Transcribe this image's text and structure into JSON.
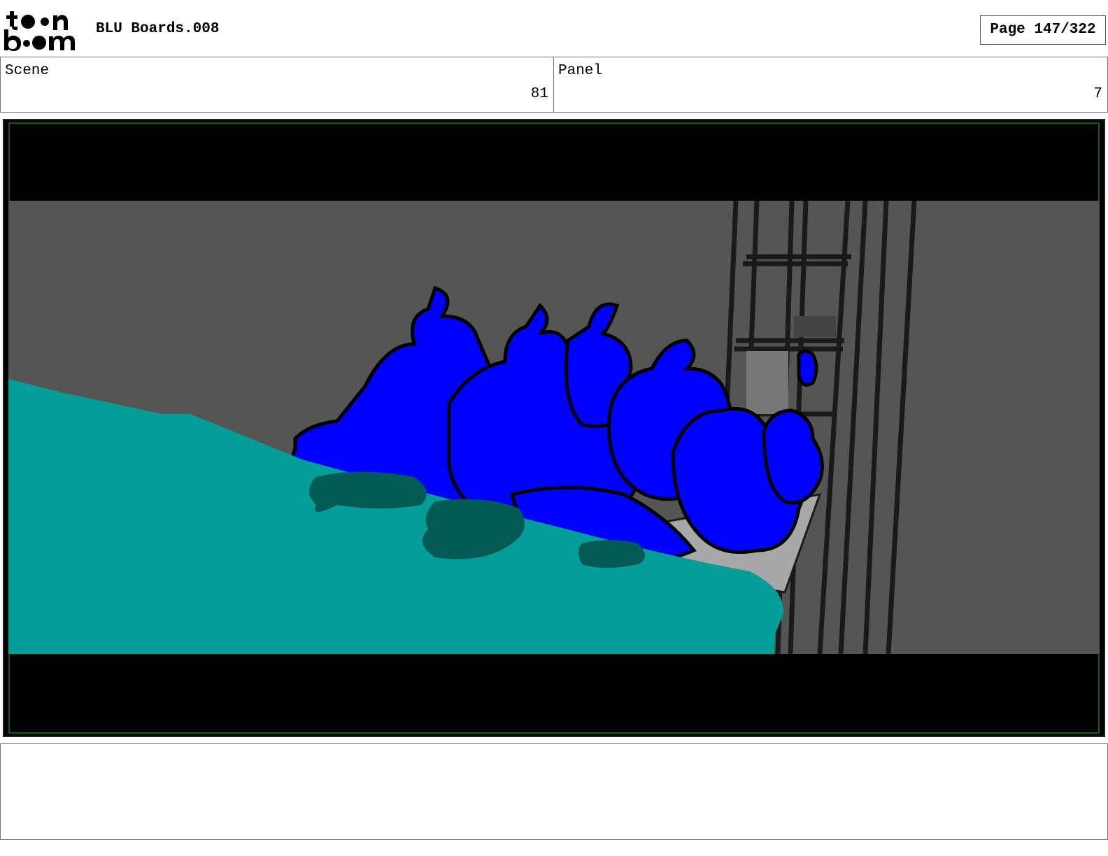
{
  "header": {
    "title": "BLU Boards.008",
    "page": "Page 147/322",
    "logo_text": "toonboom"
  },
  "scene": {
    "label": "Scene",
    "value": "81"
  },
  "panel": {
    "label": "Panel",
    "value": "7"
  },
  "notes": {
    "text": ""
  },
  "colors": {
    "frame": "#000000",
    "frame_border": "#0f5b14",
    "wall": "#555555",
    "water": "#059d98",
    "water_dark": "#045a55",
    "creatures": "#0000ff",
    "ladder": "#2a2a2a"
  },
  "icons": {
    "logo": "toon-boom-logo"
  }
}
